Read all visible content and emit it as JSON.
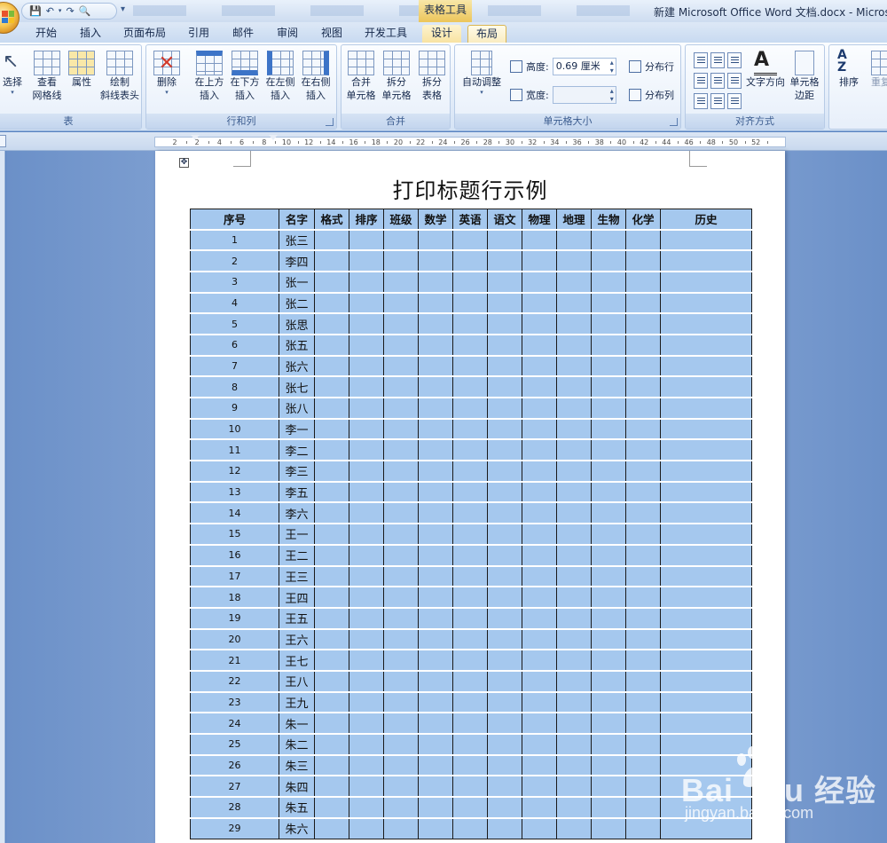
{
  "window": {
    "title": "新建 Microsoft Office Word 文档.docx - Microso",
    "contextual_tools": "表格工具"
  },
  "tabs": [
    {
      "label": "开始",
      "active": false
    },
    {
      "label": "插入",
      "active": false
    },
    {
      "label": "页面布局",
      "active": false
    },
    {
      "label": "引用",
      "active": false
    },
    {
      "label": "邮件",
      "active": false
    },
    {
      "label": "审阅",
      "active": false
    },
    {
      "label": "视图",
      "active": false
    },
    {
      "label": "开发工具",
      "active": false
    },
    {
      "label": "设计",
      "active": false
    },
    {
      "label": "布局",
      "active": true
    }
  ],
  "ribbon": {
    "groups": {
      "table": "表",
      "rows_cols": "行和列",
      "merge": "合并",
      "cell_size": "单元格大小",
      "alignment": "对齐方式"
    },
    "buttons": {
      "select": "选择",
      "view_gridlines_1": "查看",
      "view_gridlines_2": "网格线",
      "properties": "属性",
      "draw_diagonal_1": "绘制",
      "draw_diagonal_2": "斜线表头",
      "delete": "删除",
      "insert_above_1": "在上方",
      "insert_above_2": "插入",
      "insert_below_1": "在下方",
      "insert_below_2": "插入",
      "insert_left_1": "在左侧",
      "insert_left_2": "插入",
      "insert_right_1": "在右侧",
      "insert_right_2": "插入",
      "merge_cells_1": "合并",
      "merge_cells_2": "单元格",
      "split_cells_1": "拆分",
      "split_cells_2": "单元格",
      "split_table_1": "拆分",
      "split_table_2": "表格",
      "autofit": "自动调整",
      "height_label": "高度:",
      "height_value": "0.69 厘米",
      "width_label": "宽度:",
      "width_value": "",
      "distribute_rows": "分布行",
      "distribute_cols": "分布列",
      "text_direction": "文字方向",
      "cell_margins_1": "单元格",
      "cell_margins_2": "边距",
      "sort": "排序",
      "repeat_header": "重复"
    }
  },
  "ruler": {
    "ticks": [
      "2",
      "2",
      "4",
      "6",
      "8",
      "10",
      "12",
      "14",
      "16",
      "18",
      "20",
      "22",
      "24",
      "26",
      "28",
      "30",
      "32",
      "34",
      "36",
      "38",
      "40",
      "42",
      "44",
      "46",
      "48",
      "50",
      "52"
    ]
  },
  "document": {
    "heading": "打印标题行示例",
    "table": {
      "headers": [
        "序号",
        "名字",
        "格式",
        "排序",
        "班级",
        "数学",
        "英语",
        "语文",
        "物理",
        "地理",
        "生物",
        "化学",
        "历史"
      ],
      "rows": [
        {
          "no": "1",
          "name": "张三"
        },
        {
          "no": "2",
          "name": "李四"
        },
        {
          "no": "3",
          "name": "张一"
        },
        {
          "no": "4",
          "name": "张二"
        },
        {
          "no": "5",
          "name": "张思"
        },
        {
          "no": "6",
          "name": "张五"
        },
        {
          "no": "7",
          "name": "张六"
        },
        {
          "no": "8",
          "name": "张七"
        },
        {
          "no": "9",
          "name": "张八"
        },
        {
          "no": "10",
          "name": "李一"
        },
        {
          "no": "11",
          "name": "李二"
        },
        {
          "no": "12",
          "name": "李三"
        },
        {
          "no": "13",
          "name": "李五"
        },
        {
          "no": "14",
          "name": "李六"
        },
        {
          "no": "15",
          "name": "王一"
        },
        {
          "no": "16",
          "name": "王二"
        },
        {
          "no": "17",
          "name": "王三"
        },
        {
          "no": "18",
          "name": "王四"
        },
        {
          "no": "19",
          "name": "王五"
        },
        {
          "no": "20",
          "name": "王六"
        },
        {
          "no": "21",
          "name": "王七"
        },
        {
          "no": "22",
          "name": "王八"
        },
        {
          "no": "23",
          "name": "王九"
        },
        {
          "no": "24",
          "name": "朱一"
        },
        {
          "no": "25",
          "name": "朱二"
        },
        {
          "no": "26",
          "name": "朱三"
        },
        {
          "no": "27",
          "name": "朱四"
        },
        {
          "no": "28",
          "name": "朱五"
        },
        {
          "no": "29",
          "name": "朱六"
        }
      ]
    }
  },
  "watermark": {
    "brand": "Bai",
    "brand_suffix": "du",
    "brand_cn": "经验",
    "url": "jingyan.baidu.com"
  },
  "colors": {
    "table_fill": "#a5c8ee",
    "ribbon_bg": "#dbe7f6",
    "workspace": "#6b90c8",
    "tools_tab": "#f8e3a2"
  }
}
